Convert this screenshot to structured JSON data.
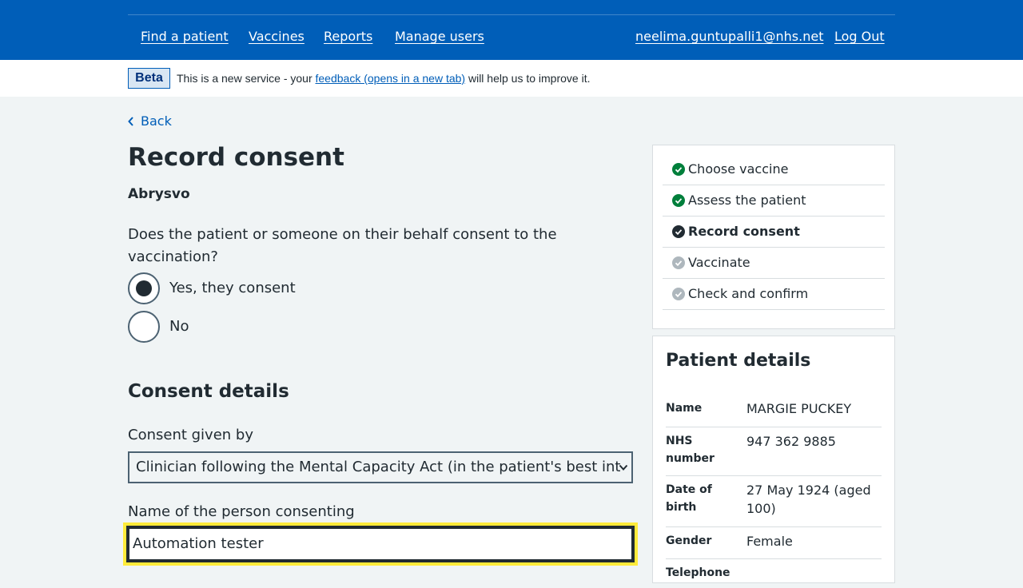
{
  "header": {
    "nav": [
      "Find a patient",
      "Vaccines",
      "Reports",
      "Manage users"
    ],
    "user_email": "neelima.guntupalli1@nhs.net",
    "logout": "Log Out"
  },
  "beta": {
    "tag": "Beta",
    "text_before": "This is a new service - your ",
    "link": "feedback (opens in a new tab)",
    "text_after": " will help us to improve it."
  },
  "back": "Back",
  "title": "Record consent",
  "vaccine": "Abrysvo",
  "question": "Does the patient or someone on their behalf consent to the vaccination?",
  "radios": [
    {
      "label": "Yes, they consent",
      "checked": true
    },
    {
      "label": "No",
      "checked": false
    }
  ],
  "consent_details": {
    "title": "Consent details",
    "given_by_label": "Consent given by",
    "given_by_value": "Clinician following the Mental Capacity Act (in the patient's best int",
    "name_label": "Name of the person consenting",
    "name_value": "Automation tester"
  },
  "steps": [
    {
      "label": "Choose vaccine",
      "status": "done"
    },
    {
      "label": "Assess the patient",
      "status": "done"
    },
    {
      "label": "Record consent",
      "status": "current"
    },
    {
      "label": "Vaccinate",
      "status": "todo"
    },
    {
      "label": "Check and confirm",
      "status": "todo"
    }
  ],
  "patient": {
    "title": "Patient details",
    "rows": [
      {
        "key": "Name",
        "value": "MARGIE PUCKEY"
      },
      {
        "key": "NHS number",
        "value": "947 362 9885"
      },
      {
        "key": "Date of birth",
        "value": "27 May 1924 (aged 100)"
      },
      {
        "key": "Gender",
        "value": "Female"
      },
      {
        "key": "Telephone",
        "value": ""
      }
    ]
  },
  "colors": {
    "header": "#005eb8",
    "done": "#007f3b",
    "current": "#212b32",
    "todo": "#aeb7bd",
    "focus": "#ffeb3b"
  }
}
